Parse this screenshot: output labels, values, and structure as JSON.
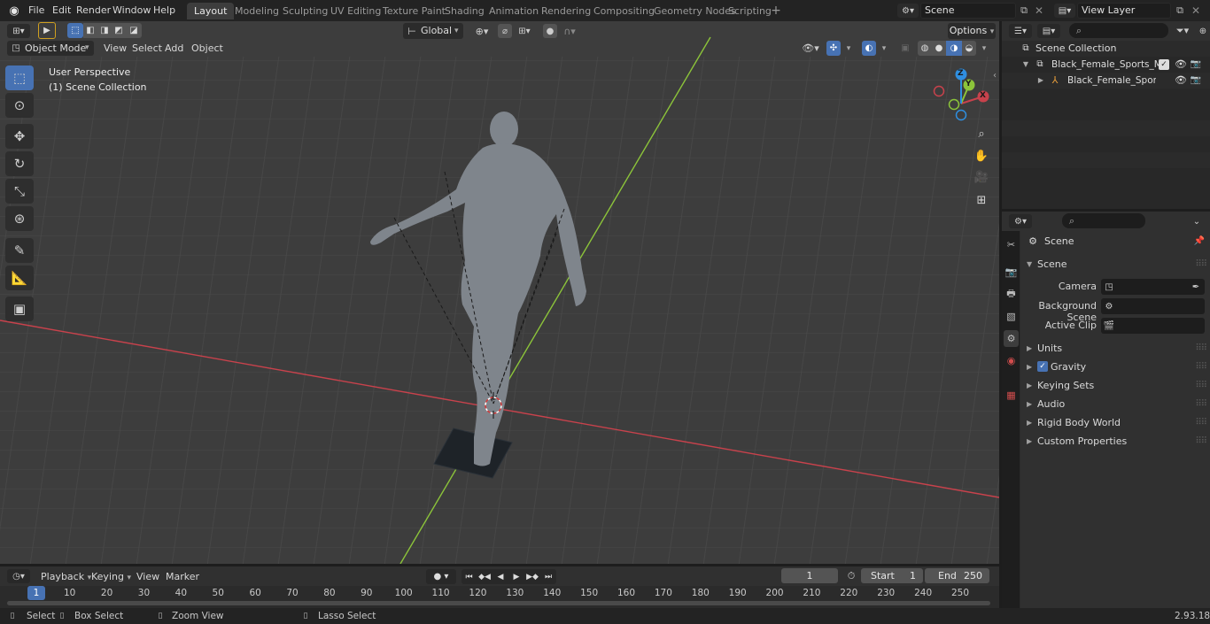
{
  "topbar": {
    "menus": [
      "File",
      "Edit",
      "Render",
      "Window",
      "Help"
    ],
    "workspaces": [
      "Layout",
      "Modeling",
      "Sculpting",
      "UV Editing",
      "Texture Paint",
      "Shading",
      "Animation",
      "Rendering",
      "Compositing",
      "Geometry Nodes",
      "Scripting"
    ],
    "active_workspace": "Layout",
    "scene_name": "Scene",
    "view_layer": "View Layer"
  },
  "viewport": {
    "mode": "Object Mode",
    "menus": [
      "View",
      "Select",
      "Add",
      "Object"
    ],
    "transform_orientation": "Global",
    "options_label": "Options",
    "overlay_title": "User Perspective",
    "overlay_subtitle": "(1) Scene Collection",
    "gizmo_axes": {
      "x": "X",
      "y": "Y",
      "z": "Z"
    },
    "colors": {
      "x_axis": "#c8424c",
      "y_axis": "#8cc43a",
      "z_axis": "#2f8fe0",
      "grid_bg": "#3d3d3d"
    }
  },
  "outliner": {
    "root": "Scene Collection",
    "items": [
      {
        "name": "Black_Female_Sports_Manne",
        "type": "collection"
      },
      {
        "name": "Black_Female_Sports_Ma",
        "type": "armature"
      }
    ]
  },
  "properties": {
    "context": "Scene",
    "panel_title": "Scene",
    "fields": [
      {
        "label": "Camera",
        "value": ""
      },
      {
        "label": "Background Scene",
        "value": ""
      },
      {
        "label": "Active Clip",
        "value": ""
      }
    ],
    "sections": [
      "Units",
      "Gravity",
      "Keying Sets",
      "Audio",
      "Rigid Body World",
      "Custom Properties"
    ],
    "gravity_checked": true
  },
  "timeline": {
    "menus": [
      "Playback",
      "Keying",
      "View",
      "Marker"
    ],
    "current_frame": "1",
    "start_label": "Start",
    "start": "1",
    "end_label": "End",
    "end": "250",
    "ticks": [
      "1",
      "10",
      "20",
      "30",
      "40",
      "50",
      "60",
      "70",
      "80",
      "90",
      "100",
      "110",
      "120",
      "130",
      "140",
      "150",
      "160",
      "170",
      "180",
      "190",
      "200",
      "210",
      "220",
      "230",
      "240",
      "250"
    ]
  },
  "statusbar": {
    "select": "Select",
    "box_select": "Box Select",
    "zoom_view": "Zoom View",
    "lasso_select": "Lasso Select",
    "version": "2.93.18"
  }
}
